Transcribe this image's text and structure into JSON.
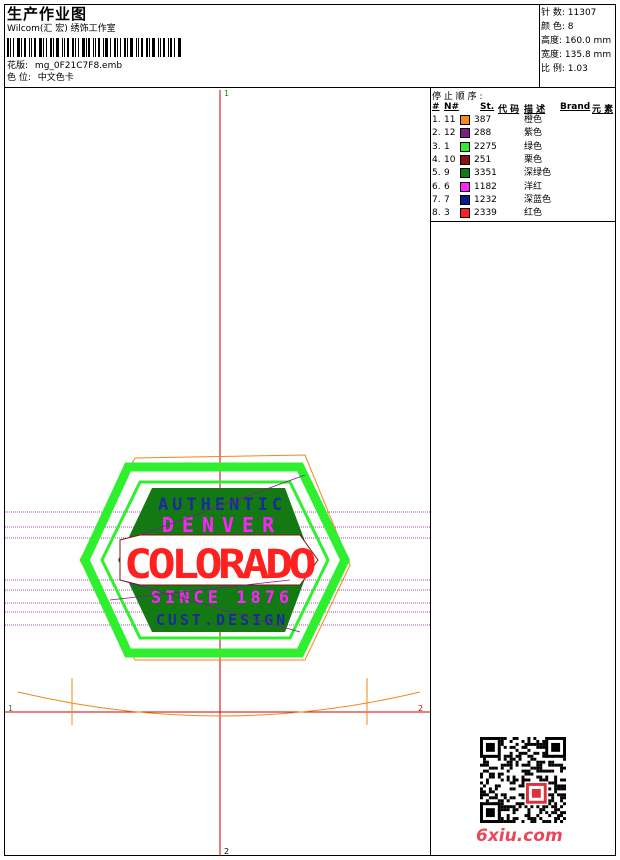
{
  "header": {
    "title": "生产作业图",
    "company": "Wilcom(汇 宏) 绣饰工作室",
    "design_label": "花版:",
    "design_value": "mg_0F21C7F8.emb",
    "color_label": "色 位:",
    "color_value": "中文色卡"
  },
  "stats": [
    {
      "label": "针 数:",
      "value": "11307"
    },
    {
      "label": "颜 色:",
      "value": "8"
    },
    {
      "label": "高度:",
      "value": "160.0 mm"
    },
    {
      "label": "宽度:",
      "value": "135.8 mm"
    },
    {
      "label": "比 例:",
      "value": "1.03"
    }
  ],
  "legend": {
    "title": "停 止 顺 序 :",
    "headers": {
      "index": "#",
      "needle": "N#",
      "st": "St.",
      "code": "代 码",
      "desc": "描 述",
      "brand": "Brand",
      "element": "元 素"
    },
    "rows": [
      {
        "index": "1.",
        "needle": "11",
        "color": "#f58a1f",
        "st": "387",
        "desc": "橙色"
      },
      {
        "index": "2.",
        "needle": "12",
        "color": "#7a1d86",
        "st": "288",
        "desc": "紫色"
      },
      {
        "index": "3.",
        "needle": "1",
        "color": "#2ef02e",
        "st": "2275",
        "desc": "绿色"
      },
      {
        "index": "4.",
        "needle": "10",
        "color": "#8b1010",
        "st": "251",
        "desc": "栗色"
      },
      {
        "index": "5.",
        "needle": "9",
        "color": "#137a13",
        "st": "3351",
        "desc": "深绿色"
      },
      {
        "index": "6.",
        "needle": "6",
        "color": "#ff22ff",
        "st": "1182",
        "desc": "洋红"
      },
      {
        "index": "7.",
        "needle": "7",
        "color": "#0b1a8c",
        "st": "1232",
        "desc": "深蓝色"
      },
      {
        "index": "8.",
        "needle": "3",
        "color": "#ff2020",
        "st": "2339",
        "desc": "红色"
      }
    ]
  },
  "axes": {
    "top": "1",
    "left": "1",
    "right": "2",
    "bottom": "2"
  },
  "design": {
    "line1": "AUTHENTIC",
    "line2": "DENVER",
    "line3": "COLORADO",
    "line4": "SINCE 1876",
    "line5": "CUST.DESIGN"
  },
  "watermark": "6xiu.com"
}
